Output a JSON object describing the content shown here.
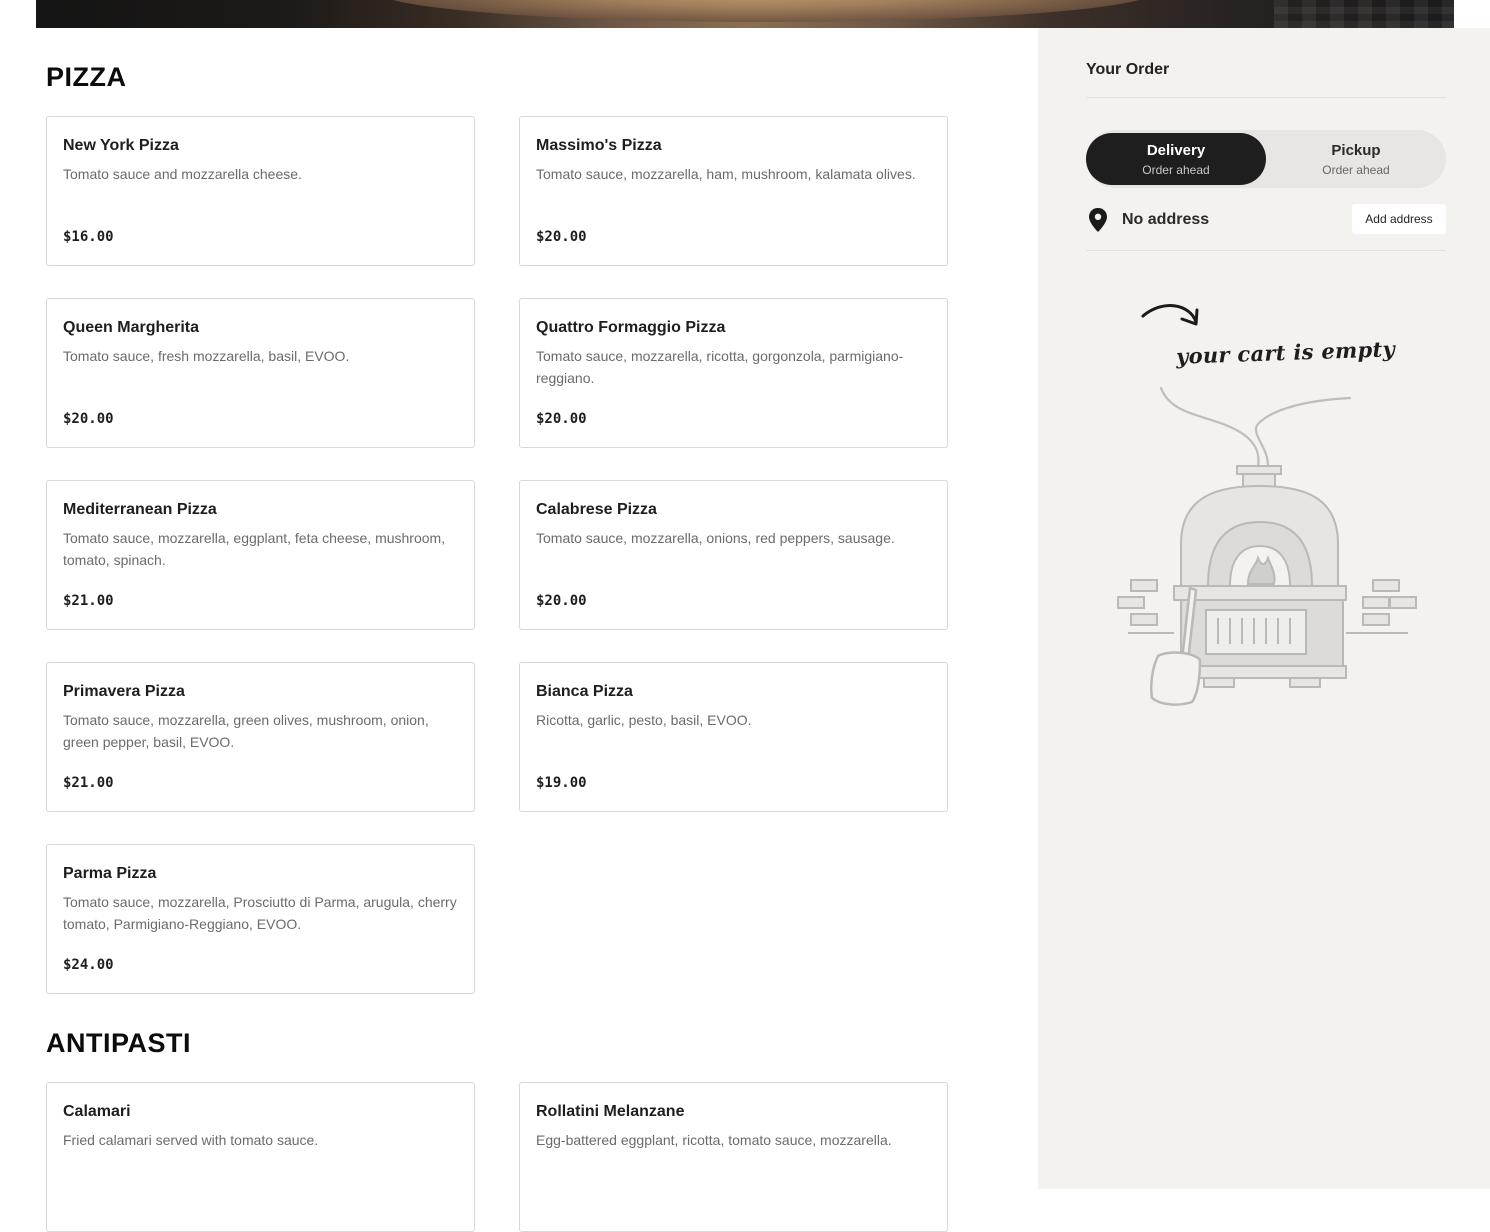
{
  "menu": {
    "pizza_title": "PIZZA",
    "pizza": [
      {
        "name": "New York Pizza",
        "description": "Tomato sauce and mozzarella cheese.",
        "price": "$16.00"
      },
      {
        "name": "Massimo's Pizza",
        "description": "Tomato sauce, mozzarella, ham, mushroom, kalamata olives.",
        "price": "$20.00"
      },
      {
        "name": "Queen Margherita",
        "description": "Tomato sauce, fresh mozzarella, basil, EVOO.",
        "price": "$20.00"
      },
      {
        "name": "Quattro Formaggio Pizza",
        "description": "Tomato sauce, mozzarella, ricotta, gorgonzola, parmigiano-reggiano.",
        "price": "$20.00"
      },
      {
        "name": "Mediterranean Pizza",
        "description": "Tomato sauce, mozzarella, eggplant, feta cheese, mushroom, tomato, spinach.",
        "price": "$21.00"
      },
      {
        "name": "Calabrese Pizza",
        "description": "Tomato sauce, mozzarella, onions, red peppers, sausage.",
        "price": "$20.00"
      },
      {
        "name": "Primavera Pizza",
        "description": "Tomato sauce, mozzarella, green olives, mushroom, onion, green pepper, basil, EVOO.",
        "price": "$21.00"
      },
      {
        "name": "Bianca Pizza",
        "description": "Ricotta, garlic, pesto, basil, EVOO.",
        "price": "$19.00"
      },
      {
        "name": "Parma Pizza",
        "description": "Tomato sauce, mozzarella, Prosciutto di Parma, arugula, cherry tomato, Parmigiano-Reggiano, EVOO.",
        "price": "$24.00"
      }
    ],
    "antipasti_title": "ANTIPASTI",
    "antipasti": [
      {
        "name": "Calamari",
        "description": "Fried calamari served with tomato sauce.",
        "price": ""
      },
      {
        "name": "Rollatini Melanzane",
        "description": "Egg-battered eggplant, ricotta, tomato sauce, mozzarella.",
        "price": ""
      }
    ]
  },
  "order": {
    "title": "Your Order",
    "delivery_label": "Delivery",
    "delivery_sub": "Order ahead",
    "pickup_label": "Pickup",
    "pickup_sub": "Order ahead",
    "address": "No address",
    "add_address_label": "Add address",
    "empty_text": "your cart is empty"
  },
  "icons": {
    "address": "map-pin-icon",
    "empty_cart": "pizza-oven-illustration",
    "arrow": "curved-arrow-icon"
  },
  "colors": {
    "sidebar_bg": "#f3f2ef",
    "toggle_active": "#1e1e1e",
    "card_border": "#d8d8d8",
    "price_text": "#1e1e1e"
  }
}
